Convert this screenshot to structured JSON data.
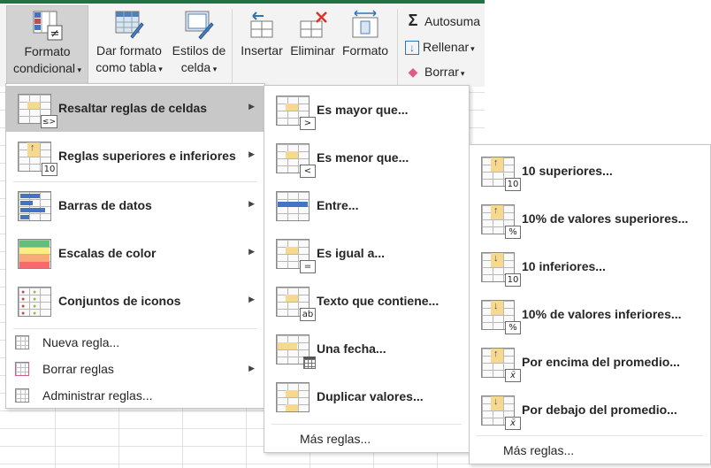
{
  "ribbon": {
    "conditional_format": {
      "line1": "Formato",
      "line2": "condicional"
    },
    "format_as_table": {
      "line1": "Dar formato",
      "line2": "como tabla"
    },
    "cell_styles": {
      "line1": "Estilos de",
      "line2": "celda"
    },
    "insert": {
      "label": "Insertar"
    },
    "delete": {
      "label": "Eliminar"
    },
    "format": {
      "label": "Formato"
    },
    "autosum": {
      "label": "Autosuma"
    },
    "fill": {
      "label": "Rellenar"
    },
    "clear": {
      "label": "Borrar"
    }
  },
  "main_menu": {
    "items": [
      {
        "label": "Resaltar reglas de celdas",
        "highlighted": true
      },
      {
        "label": "Reglas superiores e inferiores",
        "badge": "10"
      },
      {
        "label": "Barras de datos"
      },
      {
        "label": "Escalas de color"
      },
      {
        "label": "Conjuntos de iconos"
      }
    ],
    "small_items": [
      {
        "label": "Nueva regla..."
      },
      {
        "label": "Borrar reglas"
      },
      {
        "label": "Administrar reglas..."
      }
    ]
  },
  "highlight_menu": {
    "items": [
      {
        "label": "Es mayor que...",
        "badge": ">"
      },
      {
        "label": "Es menor que...",
        "badge": "<"
      },
      {
        "label": "Entre..."
      },
      {
        "label": "Es igual a...",
        "badge": "="
      },
      {
        "label": "Texto que contiene...",
        "badge": "ab"
      },
      {
        "label": "Una fecha..."
      },
      {
        "label": "Duplicar valores..."
      }
    ],
    "more": "Más reglas..."
  },
  "topbottom_menu": {
    "items": [
      {
        "label": "10 superiores...",
        "badge": "10"
      },
      {
        "label": "10% de valores superiores...",
        "badge": "%"
      },
      {
        "label": "10 inferiores...",
        "badge": "10"
      },
      {
        "label": "10% de valores inferiores...",
        "badge": "%"
      },
      {
        "label": "Por encima del promedio...",
        "badge": "x̄"
      },
      {
        "label": "Por debajo del promedio...",
        "badge": "x̄"
      }
    ],
    "more": "Más reglas..."
  },
  "colors": {
    "accent": "#217346",
    "highlight": "#c8c8c8",
    "icon_yellow": "#f6d98e",
    "icon_blue": "#4472c4"
  }
}
